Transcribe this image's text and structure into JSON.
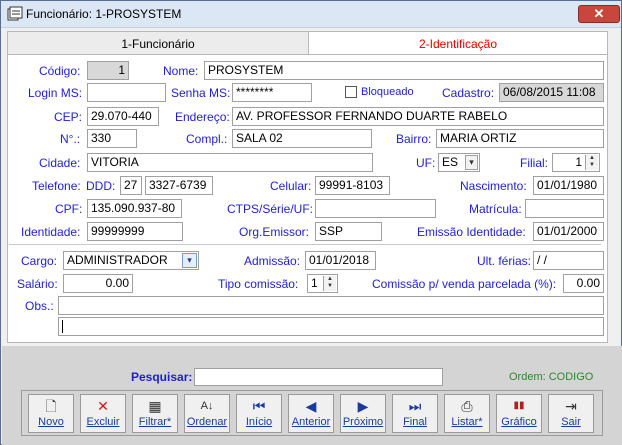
{
  "window": {
    "title": "Funcionário: 1-PROSYSTEM",
    "close_glyph": "✕"
  },
  "tabs": [
    {
      "label": "1-Funcionário"
    },
    {
      "label": "2-Identificação"
    }
  ],
  "labels": {
    "codigo": "Código:",
    "nome": "Nome:",
    "login": "Login MS:",
    "senha": "Senha MS:",
    "bloqueado": "Bloqueado",
    "cadastro": "Cadastro:",
    "cep": "CEP:",
    "endereco": "Endereço:",
    "numero": "N°.:",
    "compl": "Compl.:",
    "bairro": "Bairro:",
    "cidade": "Cidade:",
    "uf": "UF:",
    "filial": "Filial:",
    "telefone": "Telefone:",
    "ddd": "DDD:",
    "celular": "Celular:",
    "nascimento": "Nascimento:",
    "cpf": "CPF:",
    "ctps": "CTPS/Série/UF:",
    "matricula": "Matrícula:",
    "identidade": "Identidade:",
    "org_emissor": "Org.Emissor:",
    "emissao_identidade": "Emissão Identidade:",
    "cargo": "Cargo:",
    "admissao": "Admissão:",
    "ult_ferias": "Ult. férias:",
    "salario": "Salário:",
    "tipo_comissao": "Tipo comissão:",
    "comissao_parcelada": "Comissão p/ venda parcelada (%):",
    "obs": "Obs.:"
  },
  "values": {
    "codigo": "1",
    "nome": "PROSYSTEM",
    "login": "",
    "senha": "********",
    "cadastro": "06/08/2015 11:08",
    "cep": "29.070-440",
    "endereco": "AV. PROFESSOR FERNANDO DUARTE RABELO",
    "numero": "330",
    "compl": "SALA 02",
    "bairro": "MARIA ORTIZ",
    "cidade": "VITORIA",
    "uf": "ES",
    "filial": "1",
    "ddd": "27",
    "telefone": "3327-6739",
    "celular": "99991-8103",
    "nascimento": "01/01/1980",
    "cpf": "135.090.937-80",
    "ctps": "",
    "matricula": "",
    "identidade": "99999999",
    "org_emissor": "SSP",
    "emissao_identidade": "01/01/2000",
    "cargo": "ADMINISTRADOR",
    "admissao": "01/01/2018",
    "ult_ferias": " / /",
    "salario": "0.00",
    "tipo_comissao": "1",
    "comissao_parcelada": "0.00",
    "obs1": "",
    "obs2": ""
  },
  "search": {
    "label": "Pesquisar:",
    "value": "",
    "order": "Ordem: CODIGO"
  },
  "toolbar": [
    {
      "label": "Novo",
      "icon": "new-document-icon",
      "glyph": "🗋"
    },
    {
      "label": "Excluir",
      "icon": "delete-icon",
      "glyph": "✕"
    },
    {
      "label": "Filtrar*",
      "icon": "filter-icon",
      "glyph": "▦"
    },
    {
      "label": "Ordenar",
      "icon": "sort-az-icon",
      "glyph": "A↓"
    },
    {
      "label": "Início",
      "icon": "first-record-icon",
      "glyph": "⏮"
    },
    {
      "label": "Anterior",
      "icon": "previous-icon",
      "glyph": "◀"
    },
    {
      "label": "Próximo",
      "icon": "next-icon",
      "glyph": "▶"
    },
    {
      "label": "Final",
      "icon": "last-record-icon",
      "glyph": "⏭"
    },
    {
      "label": "Listar*",
      "icon": "printer-icon",
      "glyph": "⎙"
    },
    {
      "label": "Gráfico",
      "icon": "chart-icon",
      "glyph": "▮▮"
    },
    {
      "label": "Sair",
      "icon": "exit-door-icon",
      "glyph": "⇥"
    }
  ],
  "colors": {
    "label_blue": "#1f1fcc",
    "tab_active_red": "#e00000",
    "order_green": "#2a8a2a",
    "search_blue": "#1f1fcc"
  }
}
